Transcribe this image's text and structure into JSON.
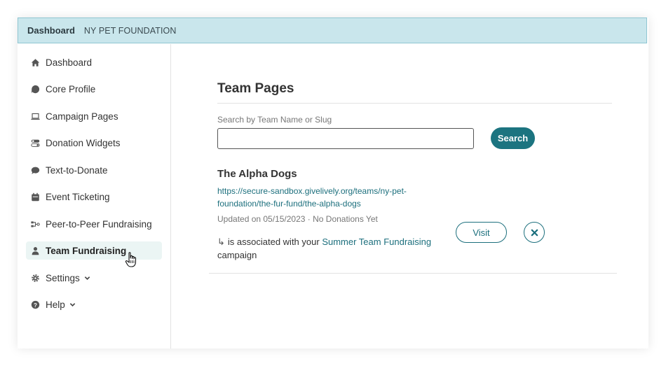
{
  "header": {
    "brand": "Dashboard",
    "org": "NY PET FOUNDATION"
  },
  "sidebar": {
    "items": [
      {
        "label": "Dashboard",
        "icon": "home-icon"
      },
      {
        "label": "Core Profile",
        "icon": "profile-shape-icon"
      },
      {
        "label": "Campaign Pages",
        "icon": "laptop-icon"
      },
      {
        "label": "Donation Widgets",
        "icon": "toggles-icon"
      },
      {
        "label": "Text-to-Donate",
        "icon": "chat-bubble-icon"
      },
      {
        "label": "Event Ticketing",
        "icon": "calendar-icon"
      },
      {
        "label": "Peer-to-Peer Fundraising",
        "icon": "peer-to-peer-icon"
      },
      {
        "label": "Team Fundraising",
        "icon": "person-icon",
        "active": true
      },
      {
        "label": "Settings",
        "icon": "gear-icon",
        "expandable": true
      },
      {
        "label": "Help",
        "icon": "help-circle-icon",
        "expandable": true
      }
    ]
  },
  "main": {
    "title": "Team Pages",
    "search": {
      "label": "Search by Team Name or Slug",
      "value": "",
      "button_label": "Search"
    },
    "teams": [
      {
        "name": "The Alpha Dogs",
        "url_line1": "https://secure-sandbox.givelively.org/teams/ny-pet-",
        "url_line2": "foundation/the-fur-fund/the-alpha-dogs",
        "meta": "Updated on 05/15/2023 · No Donations Yet",
        "assoc_prefix": "is associated with your",
        "campaign_link": "Summer Team Fundraising",
        "assoc_suffix": "campaign",
        "visit_label": "Visit"
      }
    ]
  },
  "colors": {
    "accent": "#1c7480",
    "header_bg": "#c9e6ec",
    "active_bg": "#ebf5f4"
  }
}
